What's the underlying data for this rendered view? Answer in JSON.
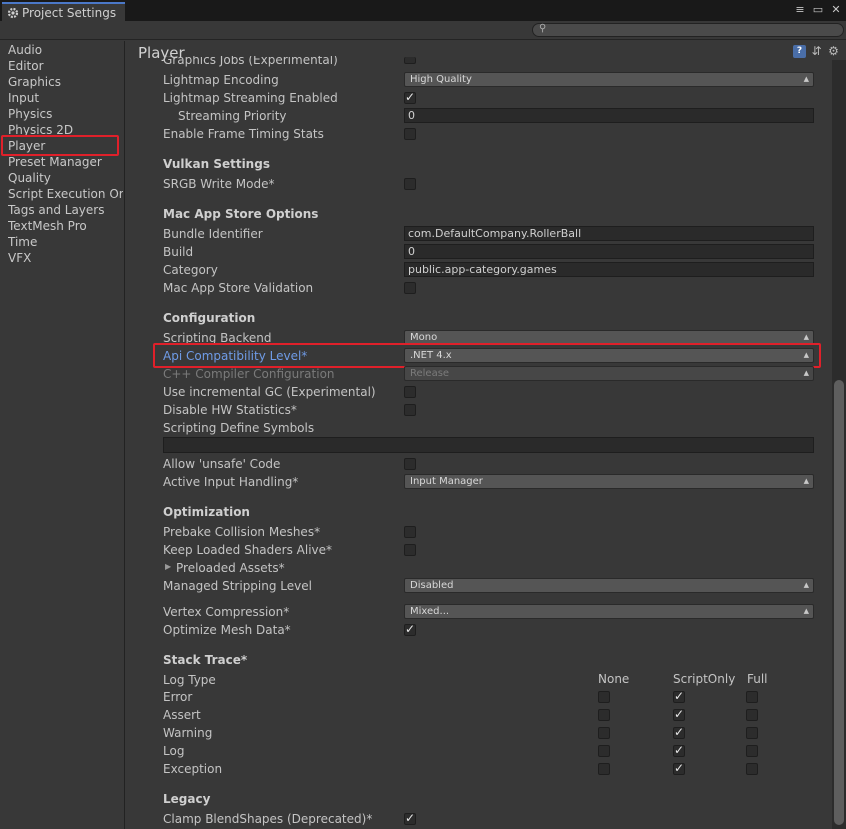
{
  "window": {
    "tab_title": "Project Settings",
    "controls": [
      "≡",
      "▭",
      "✕"
    ]
  },
  "search": {
    "placeholder": ""
  },
  "sidebar": {
    "items": [
      {
        "label": "Audio"
      },
      {
        "label": "Editor"
      },
      {
        "label": "Graphics"
      },
      {
        "label": "Input"
      },
      {
        "label": "Physics"
      },
      {
        "label": "Physics 2D"
      },
      {
        "label": "Player",
        "selected": true
      },
      {
        "label": "Preset Manager"
      },
      {
        "label": "Quality"
      },
      {
        "label": "Script Execution Order"
      },
      {
        "label": "Tags and Layers"
      },
      {
        "label": "TextMesh Pro"
      },
      {
        "label": "Time"
      },
      {
        "label": "VFX"
      }
    ]
  },
  "main": {
    "title": "Player",
    "rows": {
      "graphics_jobs": "Graphics Jobs (Experimental)",
      "lightmap_encoding": "Lightmap Encoding",
      "lightmap_encoding_value": "High Quality",
      "lightmap_streaming": "Lightmap Streaming Enabled",
      "streaming_priority": "Streaming Priority",
      "streaming_priority_value": "0",
      "frame_timing": "Enable Frame Timing Stats",
      "vulkan_header": "Vulkan Settings",
      "srgb_write": "SRGB Write Mode*",
      "mac_header": "Mac App Store Options",
      "bundle_id": "Bundle Identifier",
      "bundle_id_value": "com.DefaultCompany.RollerBall",
      "build": "Build",
      "build_value": "0",
      "category": "Category",
      "category_value": "public.app-category.games",
      "mac_validation": "Mac App Store Validation",
      "config_header": "Configuration",
      "scripting_backend": "Scripting Backend",
      "scripting_backend_value": "Mono",
      "api_level": "Api Compatibility Level*",
      "api_level_value": ".NET 4.x",
      "cpp_config": "C++ Compiler Configuration",
      "cpp_config_value": "Release",
      "incremental_gc": "Use incremental GC (Experimental)",
      "hw_stats": "Disable HW Statistics*",
      "define_symbols": "Scripting Define Symbols",
      "unsafe_code": "Allow 'unsafe' Code",
      "input_handling": "Active Input Handling*",
      "input_handling_value": "Input Manager",
      "opt_header": "Optimization",
      "prebake": "Prebake Collision Meshes*",
      "keep_shaders": "Keep Loaded Shaders Alive*",
      "preloaded": "Preloaded Assets*",
      "stripping": "Managed Stripping Level",
      "stripping_value": "Disabled",
      "vertex_comp": "Vertex Compression*",
      "vertex_comp_value": "Mixed...",
      "optimize_mesh": "Optimize Mesh Data*",
      "stack_header": "Stack Trace*",
      "log_type": "Log Type",
      "col_none": "None",
      "col_scriptonly": "ScriptOnly",
      "col_full": "Full",
      "log_error": "Error",
      "log_assert": "Assert",
      "log_warning": "Warning",
      "log_log": "Log",
      "log_exception": "Exception",
      "legacy_header": "Legacy",
      "clamp_blend": "Clamp BlendShapes (Deprecated)*"
    }
  },
  "colors": {
    "highlight": "#e0202a",
    "blue_label": "#6f9be6",
    "tab_accent": "#4b78c8"
  }
}
